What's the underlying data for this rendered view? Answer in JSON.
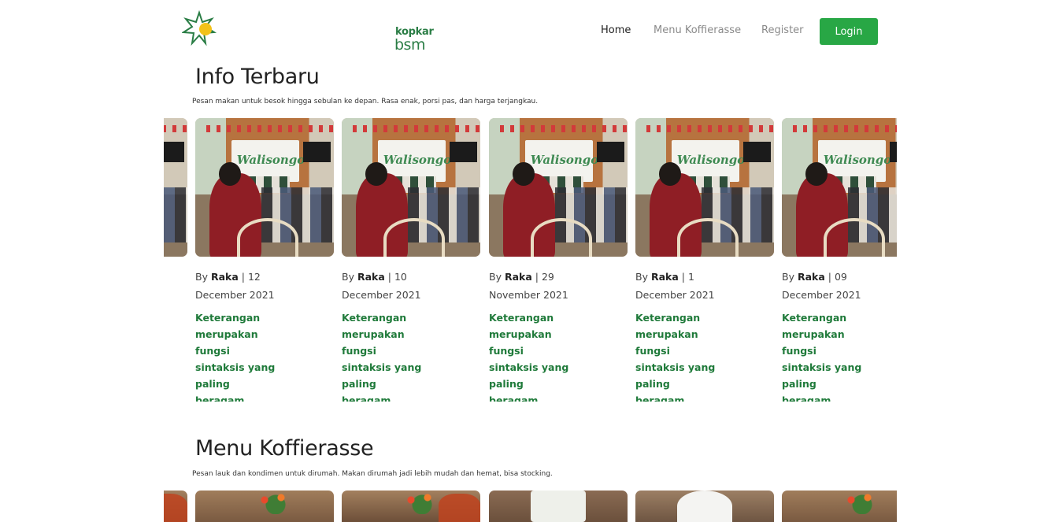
{
  "brand": {
    "line1": "kopkar",
    "line2": "bsm"
  },
  "nav": {
    "home": "Home",
    "menu": "Menu Koffierasse",
    "register": "Register",
    "login": "Login"
  },
  "info_section": {
    "title": "Info Terbaru",
    "subtitle": "Pesan makan untuk besok hingga sebulan ke depan. Rasa enak, porsi pas, dan harga terjangkau.",
    "banner_text": "Walisongo",
    "cards": [
      {
        "by": "By",
        "author": "Raka",
        "date_day": "| 12",
        "date_rest": "December 2021",
        "desc": "Keterangan merupakan fungsi sintaksis yang paling beragam"
      },
      {
        "by": "By",
        "author": "Raka",
        "date_day": "| 10",
        "date_rest": "December 2021",
        "desc": "Keterangan merupakan fungsi sintaksis yang paling beragam"
      },
      {
        "by": "By",
        "author": "Raka",
        "date_day": "| 29",
        "date_rest": "November 2021",
        "desc": "Keterangan merupakan fungsi sintaksis yang paling beragam"
      },
      {
        "by": "By",
        "author": "Raka",
        "date_day": "| 1",
        "date_rest": "December 2021",
        "desc": "Keterangan merupakan fungsi sintaksis yang paling beragam"
      },
      {
        "by": "By",
        "author": "Raka",
        "date_day": "| 09",
        "date_rest": "December 2021",
        "desc": "Keterangan merupakan fungsi sintaksis yang paling beragam"
      }
    ]
  },
  "menu_section": {
    "title": "Menu Koffierasse",
    "subtitle": "Pesan lauk dan kondimen untuk dirumah. Makan dirumah jadi lebih mudah dan hemat, bisa stocking."
  },
  "colors": {
    "accent": "#28a745",
    "desc_green": "#1f7a3a"
  }
}
